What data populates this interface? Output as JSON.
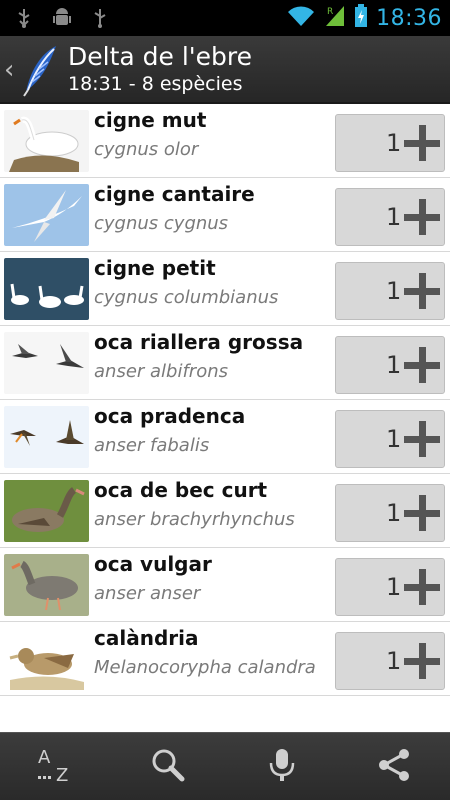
{
  "status_bar": {
    "time": "18:36",
    "icons": [
      "usb-icon",
      "android-debug-icon",
      "usb-icon",
      "wifi-icon",
      "signal-icon",
      "battery-charging-icon"
    ]
  },
  "action_bar": {
    "title": "Delta de l'ebre",
    "subtitle": "18:31 - 8 espècies"
  },
  "species": [
    {
      "name": "cigne mut",
      "latin": "cygnus olor",
      "count": "1"
    },
    {
      "name": "cigne cantaire",
      "latin": "cygnus cygnus",
      "count": "1"
    },
    {
      "name": "cigne petit",
      "latin": "cygnus columbianus",
      "count": "1"
    },
    {
      "name": "oca riallera grossa",
      "latin": "anser albifrons",
      "count": "1"
    },
    {
      "name": "oca pradenca",
      "latin": "anser fabalis",
      "count": "1"
    },
    {
      "name": "oca de bec curt",
      "latin": "anser brachyrhynchus",
      "count": "1"
    },
    {
      "name": "oca vulgar",
      "latin": "anser anser",
      "count": "1"
    },
    {
      "name": "calàndria",
      "latin": "Melanocorypha calandra",
      "count": "1"
    }
  ],
  "bottom_bar": {
    "sort": "A-Z sort",
    "icons": [
      "sort-az-icon",
      "search-icon",
      "microphone-icon",
      "share-icon"
    ]
  },
  "colors": {
    "status_accent": "#33b5e5",
    "action_bar": "#2f2f2f",
    "count_button": "#d8d8d8"
  }
}
